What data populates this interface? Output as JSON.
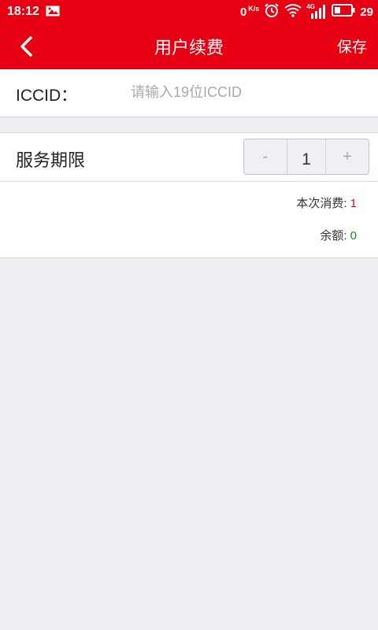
{
  "status_bar": {
    "time": "18:12",
    "net_speed": "0",
    "net_speed_unit": "K/s",
    "network_type": "4G",
    "battery": "29"
  },
  "header": {
    "title": "用户续费",
    "save_label": "保存"
  },
  "iccid": {
    "label": "ICCID：",
    "placeholder": "请输入19位ICCID",
    "value": ""
  },
  "service_period": {
    "label": "服务期限",
    "minus": "-",
    "value": "1",
    "plus": "+"
  },
  "summary": {
    "cost_label": "本次消费:",
    "cost_value": "1",
    "balance_label": "余额:",
    "balance_value": "0"
  },
  "colors": {
    "accent": "#e60012",
    "balance": "#1a8a1a",
    "background": "#eceef1"
  }
}
